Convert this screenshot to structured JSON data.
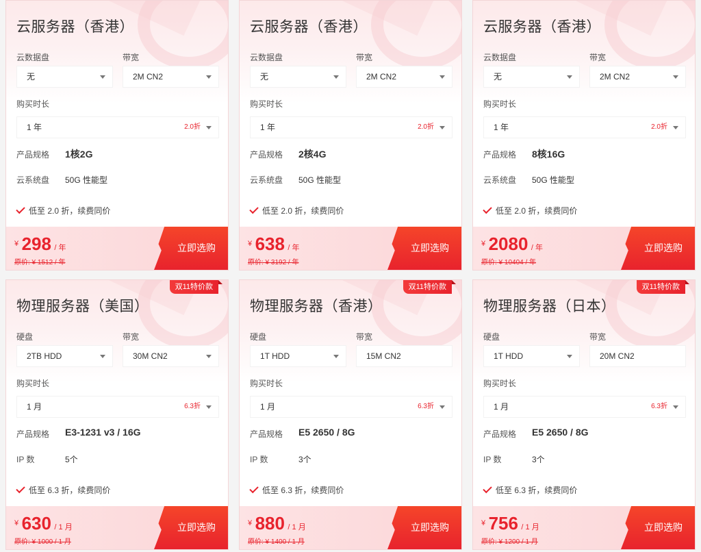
{
  "cards": [
    {
      "title": "云服务器（香港）",
      "badge": "",
      "field1_label": "云数据盘",
      "field1_value": "无",
      "field2_label": "带宽",
      "field2_value": "2M CN2",
      "duration_label": "购买时长",
      "duration_value": "1 年",
      "duration_discount": "2.0折",
      "spec_label": "产品规格",
      "spec_value": "1核2G",
      "extra_label": "云系统盘",
      "extra_value": "50G 性能型",
      "promo": "低至 2.0 折，续费同价",
      "currency": "¥",
      "price": "298",
      "price_unit": "/ 年",
      "original_price": "原价: ¥ 1512 / 年",
      "buy_label": "立即选购"
    },
    {
      "title": "云服务器（香港）",
      "badge": "",
      "field1_label": "云数据盘",
      "field1_value": "无",
      "field2_label": "带宽",
      "field2_value": "2M CN2",
      "duration_label": "购买时长",
      "duration_value": "1 年",
      "duration_discount": "2.0折",
      "spec_label": "产品规格",
      "spec_value": "2核4G",
      "extra_label": "云系统盘",
      "extra_value": "50G 性能型",
      "promo": "低至 2.0 折，续费同价",
      "currency": "¥",
      "price": "638",
      "price_unit": "/ 年",
      "original_price": "原价: ¥ 3192 / 年",
      "buy_label": "立即选购"
    },
    {
      "title": "云服务器（香港）",
      "badge": "",
      "field1_label": "云数据盘",
      "field1_value": "无",
      "field2_label": "带宽",
      "field2_value": "2M CN2",
      "duration_label": "购买时长",
      "duration_value": "1 年",
      "duration_discount": "2.0折",
      "spec_label": "产品规格",
      "spec_value": "8核16G",
      "extra_label": "云系统盘",
      "extra_value": "50G 性能型",
      "promo": "低至 2.0 折，续费同价",
      "currency": "¥",
      "price": "2080",
      "price_unit": "/ 年",
      "original_price": "原价: ¥ 10404 / 年",
      "buy_label": "立即选购"
    },
    {
      "title": "物理服务器（美国）",
      "badge": "双11特价款",
      "field1_label": "硬盘",
      "field1_value": "2TB HDD",
      "field2_label": "带宽",
      "field2_value": "30M CN2",
      "duration_label": "购买时长",
      "duration_value": "1 月",
      "duration_discount": "6.3折",
      "spec_label": "产品规格",
      "spec_value": "E3-1231 v3 / 16G",
      "extra_label": "IP 数",
      "extra_value": "5个",
      "promo": "低至 6.3 折，续费同价",
      "currency": "¥",
      "price": "630",
      "price_unit": "/ 1 月",
      "original_price": "原价: ¥ 1000 / 1 月",
      "buy_label": "立即选购"
    },
    {
      "title": "物理服务器（香港）",
      "badge": "双11特价款",
      "field1_label": "硬盘",
      "field1_value": "1T HDD",
      "field2_label": "带宽",
      "field2_value": "15M CN2",
      "duration_label": "购买时长",
      "duration_value": "1 月",
      "duration_discount": "6.3折",
      "spec_label": "产品规格",
      "spec_value": "E5 2650 / 8G",
      "extra_label": "IP 数",
      "extra_value": "3个",
      "promo": "低至 6.3 折，续费同价",
      "currency": "¥",
      "price": "880",
      "price_unit": "/ 1 月",
      "original_price": "原价: ¥ 1400 / 1 月",
      "buy_label": "立即选购"
    },
    {
      "title": "物理服务器（日本）",
      "badge": "双11特价款",
      "field1_label": "硬盘",
      "field1_value": "1T HDD",
      "field2_label": "带宽",
      "field2_value": "20M CN2",
      "duration_label": "购买时长",
      "duration_value": "1 月",
      "duration_discount": "6.3折",
      "spec_label": "产品规格",
      "spec_value": "E5 2650 / 8G",
      "extra_label": "IP 数",
      "extra_value": "3个",
      "promo": "低至 6.3 折，续费同价",
      "currency": "¥",
      "price": "756",
      "price_unit": "/ 1 月",
      "original_price": "原价: ¥ 1200 / 1 月",
      "buy_label": "立即选购"
    }
  ],
  "colors": {
    "accent": "#e8232d",
    "card_bg_top": "#fde9ea",
    "footer_bg": "#fde3e4"
  }
}
